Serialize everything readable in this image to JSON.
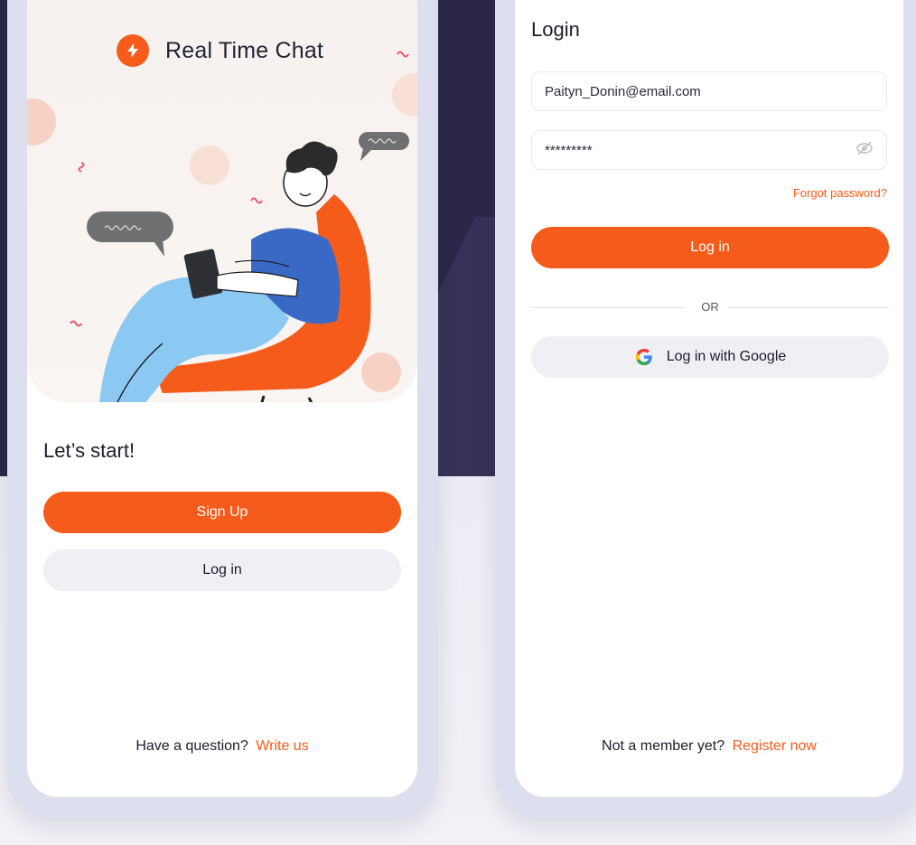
{
  "colors": {
    "accent": "#f55b1a",
    "background_dark": "#2a2748",
    "secondary_button": "#efeff4"
  },
  "welcome": {
    "app_title": "Real Time Chat",
    "heading": "Let’s start!",
    "signup_label": "Sign Up",
    "login_label": "Log in",
    "footer_prefix": "Have a question?",
    "footer_link": "Write us"
  },
  "login": {
    "title": "Login",
    "email_value": "Paityn_Donin@email.com",
    "password_value": "*********",
    "forgot_label": "Forgot password?",
    "login_button": "Log in",
    "or_label": "OR",
    "google_button": "Log in with Google",
    "footer_prefix": "Not a member yet?",
    "footer_link": "Register now"
  },
  "icons": [
    "bolt-logo-icon",
    "eye-off-icon",
    "google-icon"
  ]
}
